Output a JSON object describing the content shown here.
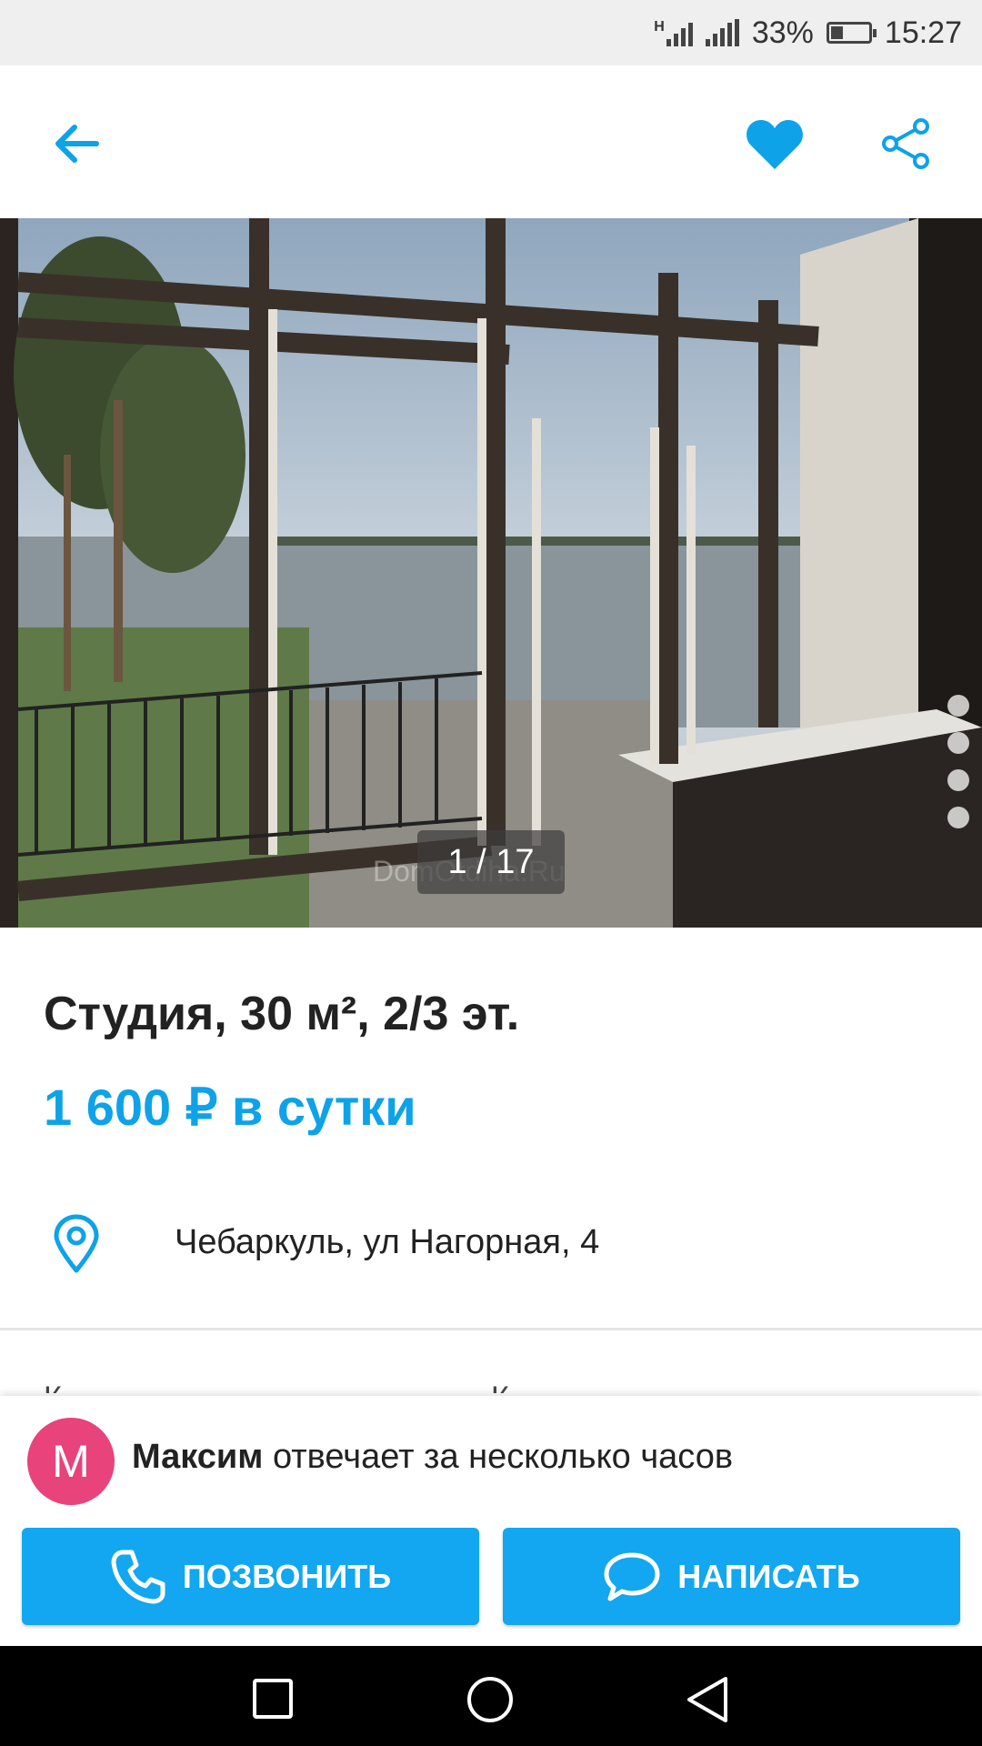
{
  "status_bar": {
    "network": "H",
    "battery": "33%",
    "battery_level": 0.33,
    "time": "15:27"
  },
  "header": {
    "back_icon": "arrow-left-icon",
    "favorite_icon": "heart-icon",
    "share_icon": "share-icon"
  },
  "gallery": {
    "counter": "1 / 17",
    "watermark": "DomOtdiha.Ru",
    "dots_count": 4
  },
  "listing": {
    "title": "Студия, 30 м², 2/3 эт.",
    "price": "1 600 ₽ в сутки",
    "address": "Чебаркуль, ул Нагорная, 4"
  },
  "peek_row": {
    "left": "К",
    "right": "К"
  },
  "host": {
    "avatar_letter": "M",
    "name": "Максим",
    "response": "отвечает за несколько часов"
  },
  "actions": {
    "call_label": "ПОЗВОНИТЬ",
    "message_label": "НАПИСАТЬ"
  },
  "colors": {
    "accent": "#0ea2e8",
    "button": "#12a7f0",
    "avatar": "#e8437a"
  },
  "nav": {
    "icons": [
      "square-icon",
      "circle-icon",
      "triangle-back-icon"
    ]
  }
}
